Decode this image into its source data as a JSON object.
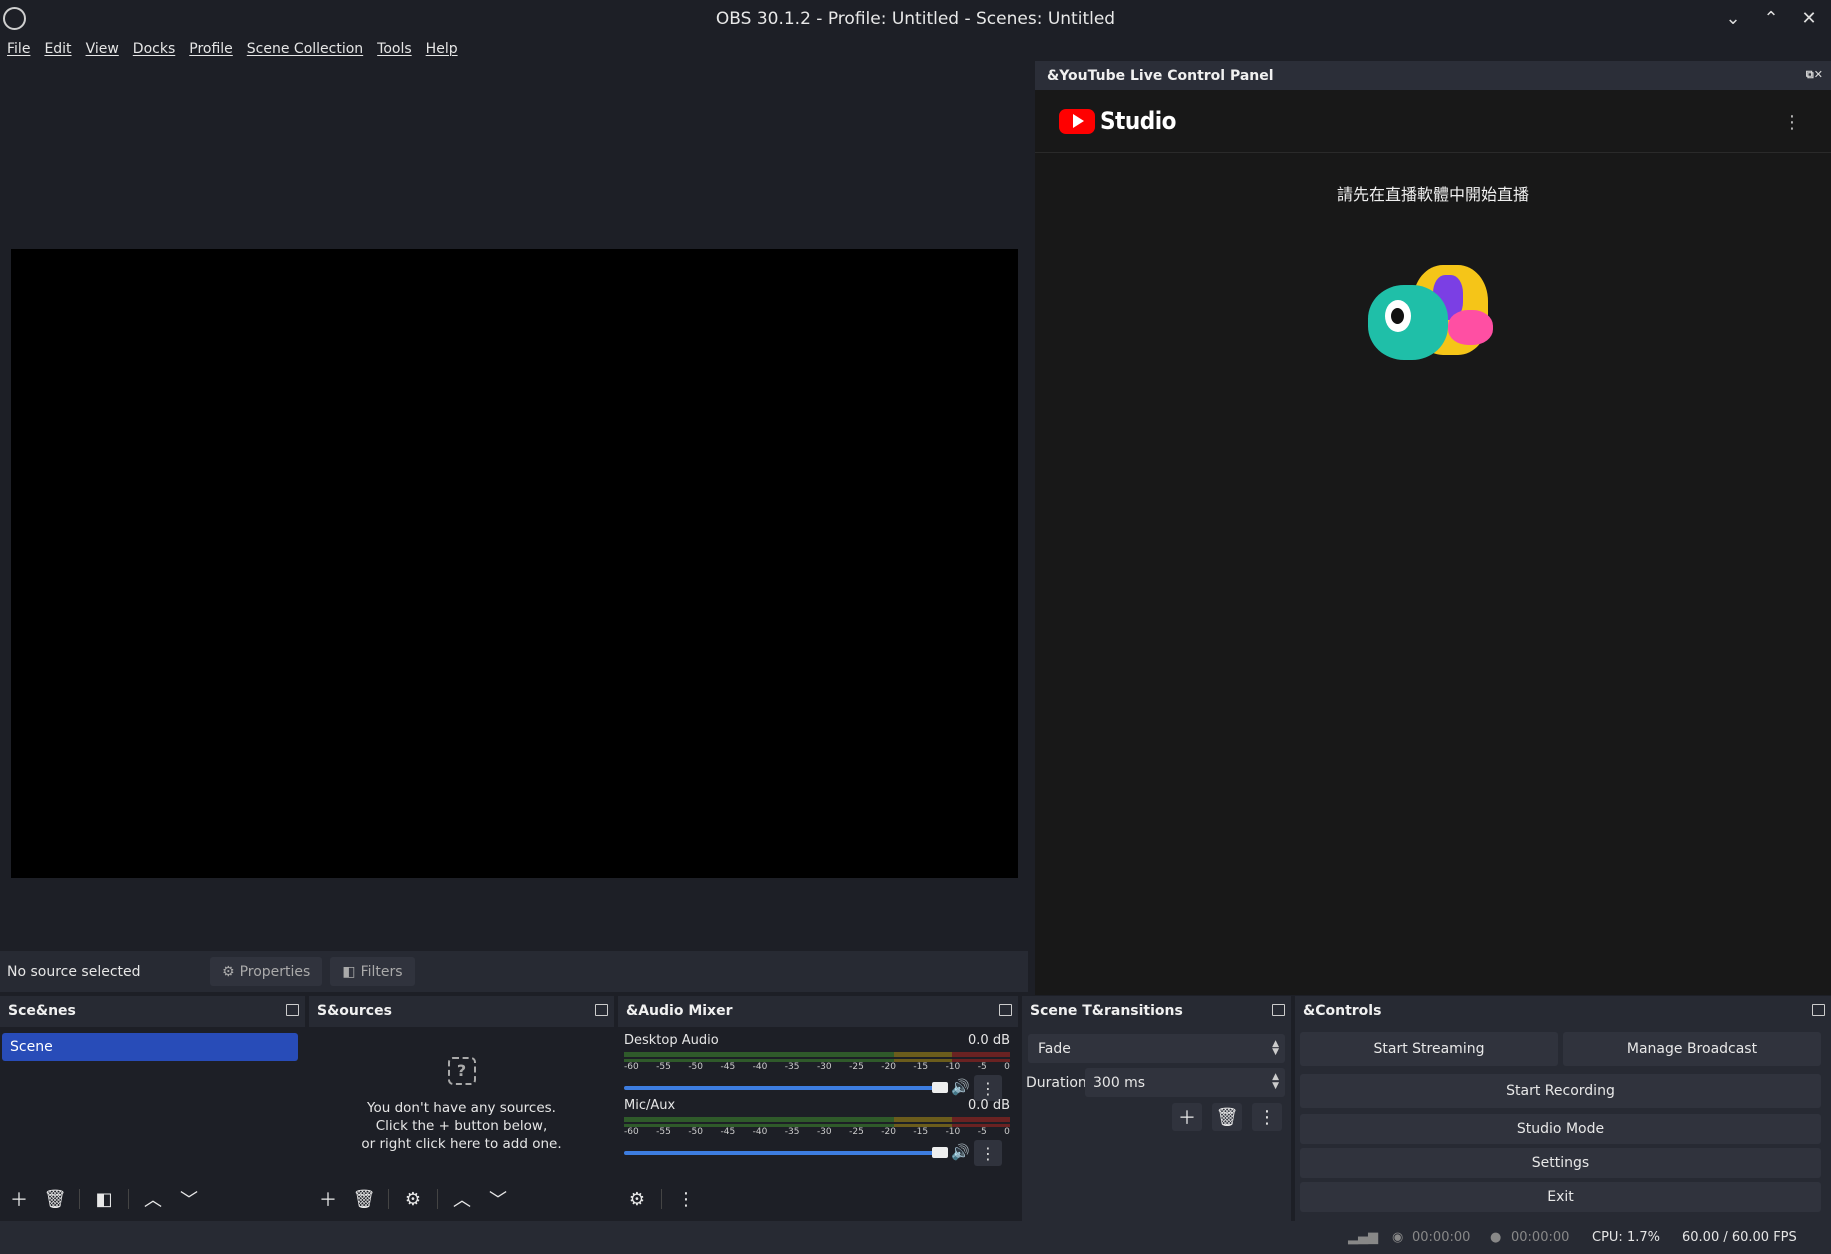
{
  "window": {
    "title": "OBS 30.1.2 - Profile: Untitled - Scenes: Untitled"
  },
  "menu": [
    "File",
    "Edit",
    "View",
    "Docks",
    "Profile",
    "Scene Collection",
    "Tools",
    "Help"
  ],
  "youtube_panel": {
    "title": "&YouTube Live Control Panel",
    "brand": "Studio",
    "message": "請先在直播軟體中開始直播"
  },
  "source_bar": {
    "no_selection": "No source selected",
    "properties": "Properties",
    "filters": "Filters"
  },
  "scenes": {
    "title": "Sce&nes",
    "items": [
      "Scene"
    ]
  },
  "sources": {
    "title": "S&ources",
    "empty_line1": "You don't have any sources.",
    "empty_line2": "Click the + button below,",
    "empty_line3": "or right click here to add one."
  },
  "mixer": {
    "title": "&Audio Mixer",
    "channels": [
      {
        "name": "Desktop Audio",
        "db": "0.0 dB",
        "volume_fraction": 1.0
      },
      {
        "name": "Mic/Aux",
        "db": "0.0 dB",
        "volume_fraction": 1.0
      }
    ],
    "ticks": [
      "-60",
      "-55",
      "-50",
      "-45",
      "-40",
      "-35",
      "-30",
      "-25",
      "-20",
      "-15",
      "-10",
      "-5",
      "0"
    ]
  },
  "transitions": {
    "title": "Scene T&ransitions",
    "selected": "Fade",
    "duration_label": "Duration",
    "duration_value": "300 ms"
  },
  "controls": {
    "title": "&Controls",
    "start_streaming": "Start Streaming",
    "manage_broadcast": "Manage Broadcast",
    "start_recording": "Start Recording",
    "studio_mode": "Studio Mode",
    "settings": "Settings",
    "exit": "Exit"
  },
  "status": {
    "stream_time": "00:00:00",
    "record_time": "00:00:00",
    "cpu": "CPU: 1.7%",
    "fps": "60.00 / 60.00 FPS"
  },
  "colors": {
    "accent": "#284cb8",
    "slider": "#3d7de0",
    "bg": "#1d1f26",
    "dock": "#272a33"
  }
}
